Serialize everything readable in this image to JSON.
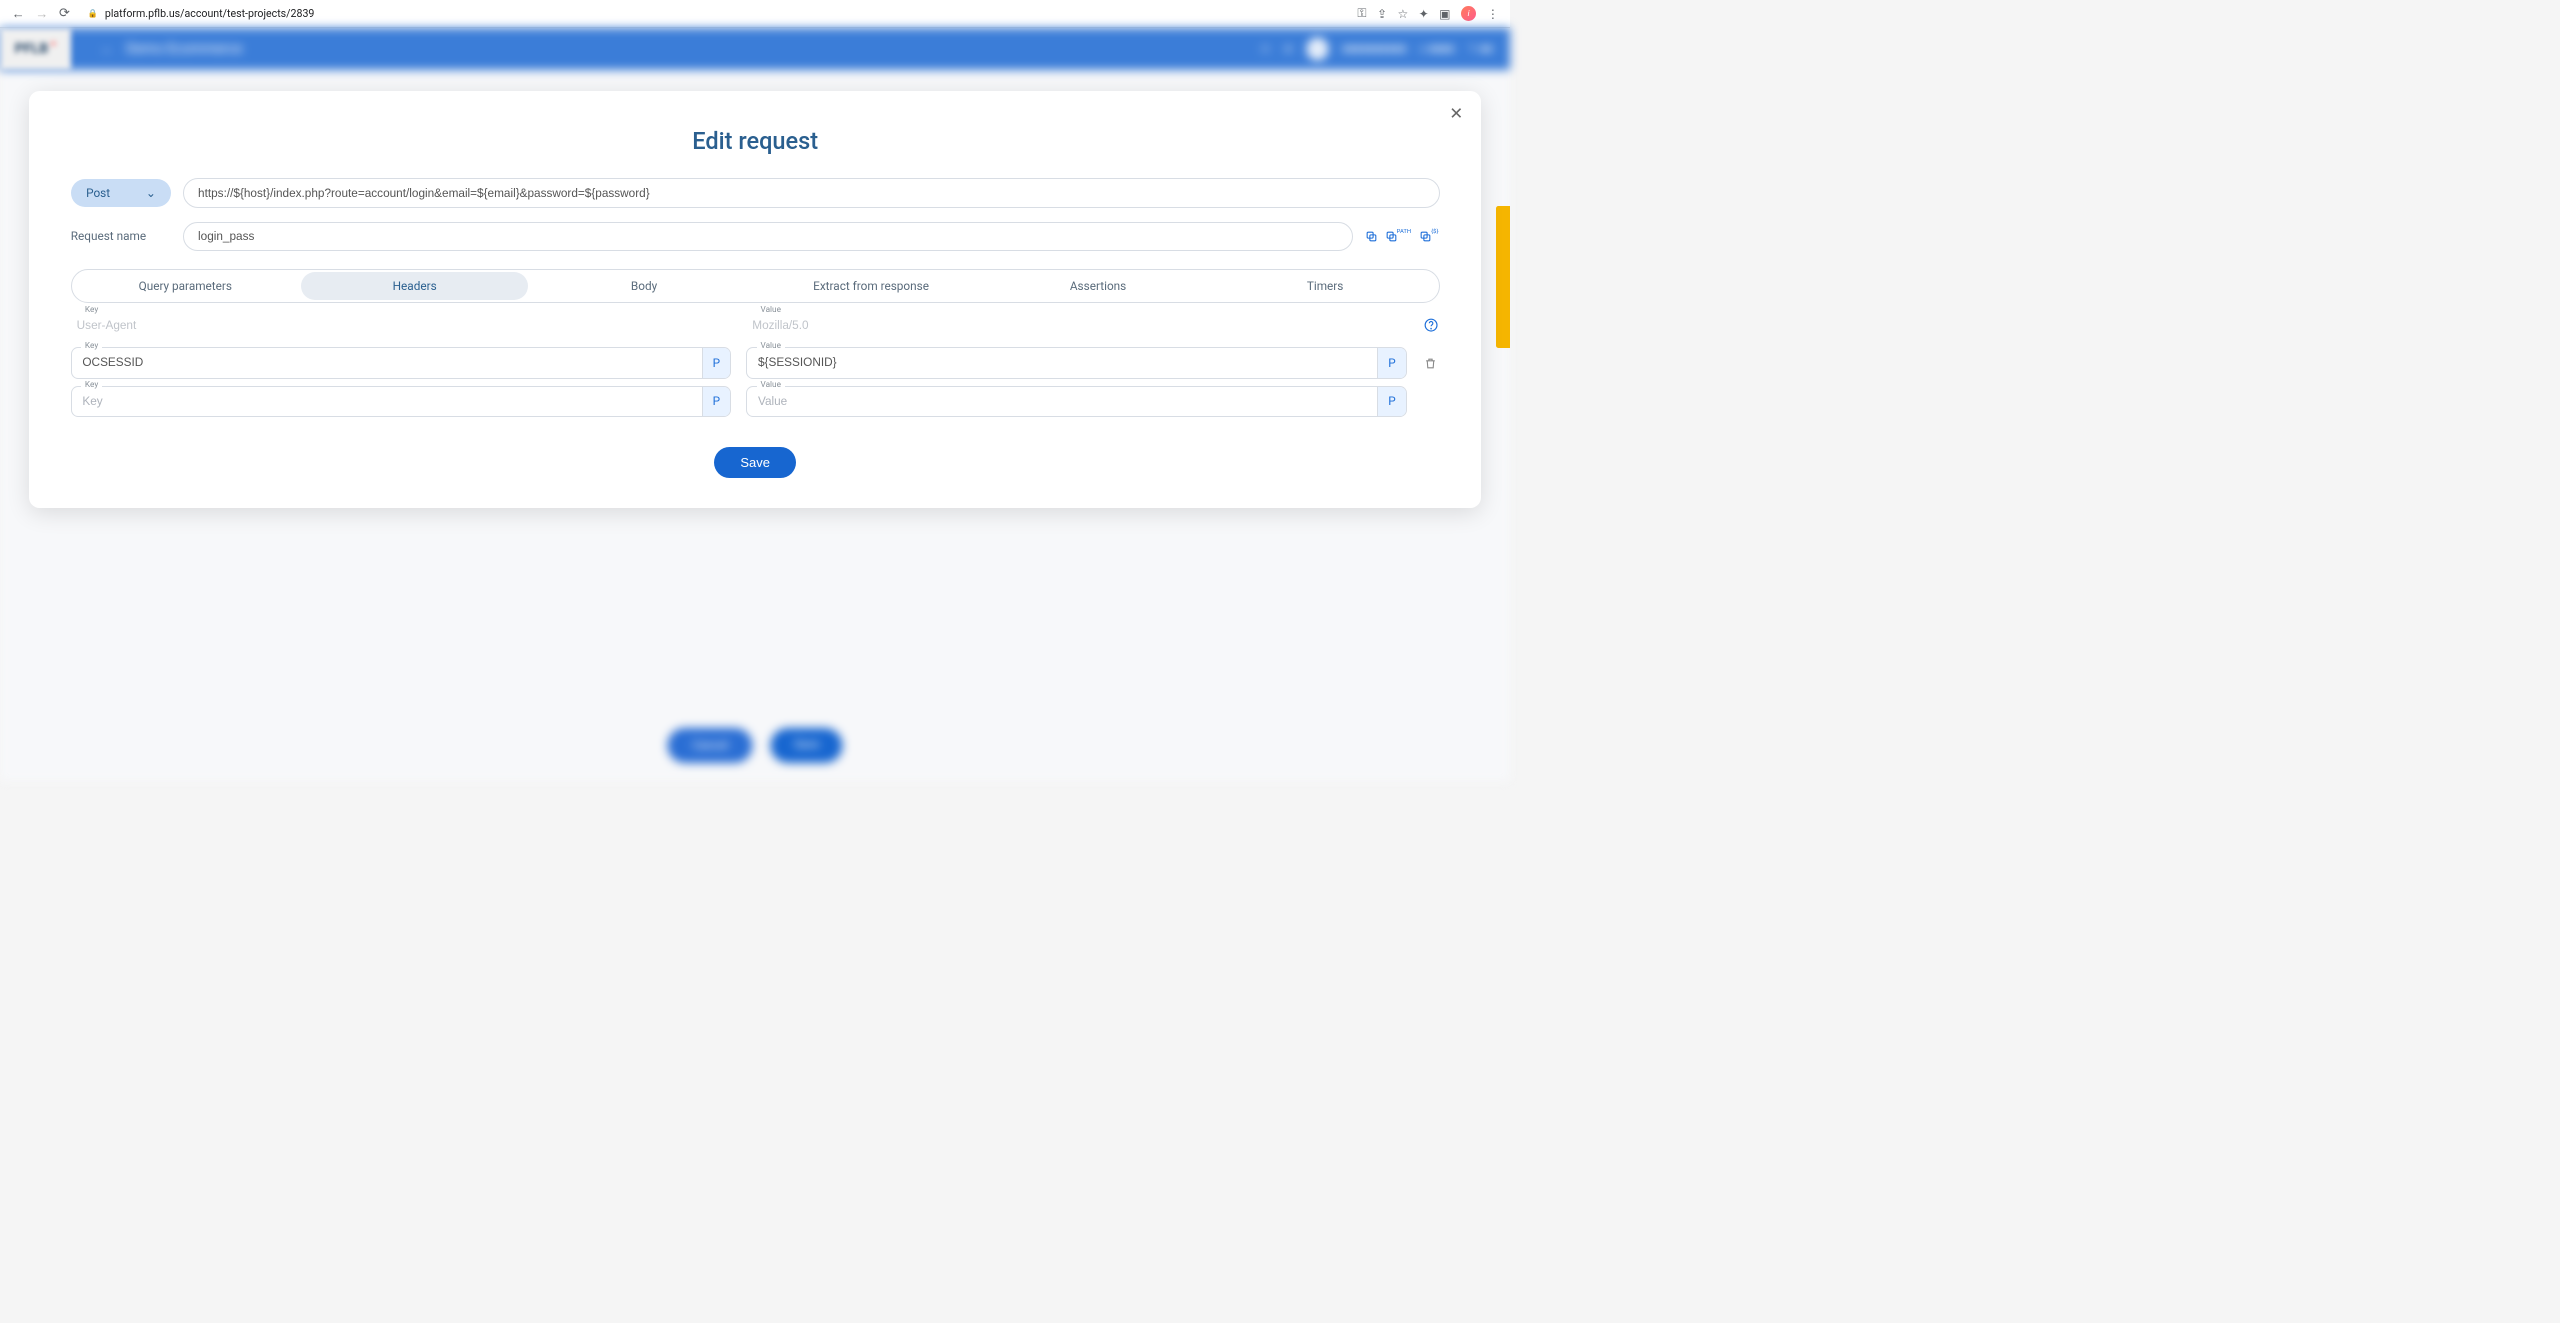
{
  "browser": {
    "url": "platform.pflb.us/account/test-projects/2839"
  },
  "app": {
    "logo": "PFLB",
    "header_title": "Demo Ecommerce",
    "bg_cancel": "Cancel",
    "bg_save": "Save"
  },
  "modal": {
    "title": "Edit request",
    "method": "Post",
    "url": "https://${host}/index.php?route=account/login&email=${email}&password=${password}",
    "request_name_label": "Request name",
    "request_name": "login_pass",
    "tabs": {
      "query": "Query parameters",
      "headers": "Headers",
      "body": "Body",
      "extract": "Extract from response",
      "assertions": "Assertions",
      "timers": "Timers"
    },
    "labels": {
      "key": "Key",
      "value": "Value"
    },
    "placeholders": {
      "key": "Key",
      "value": "Value"
    },
    "headers_rows": [
      {
        "key": "User-Agent",
        "value": "Mozilla/5.0",
        "readonly": true
      },
      {
        "key": "OCSESSID",
        "value": "${SESSIONID}",
        "readonly": false
      },
      {
        "key": "",
        "value": "",
        "readonly": false
      }
    ],
    "p_button": "P",
    "save_button": "Save",
    "action_copy_path_super": "PATH",
    "action_copy_var_super": "{$}"
  }
}
